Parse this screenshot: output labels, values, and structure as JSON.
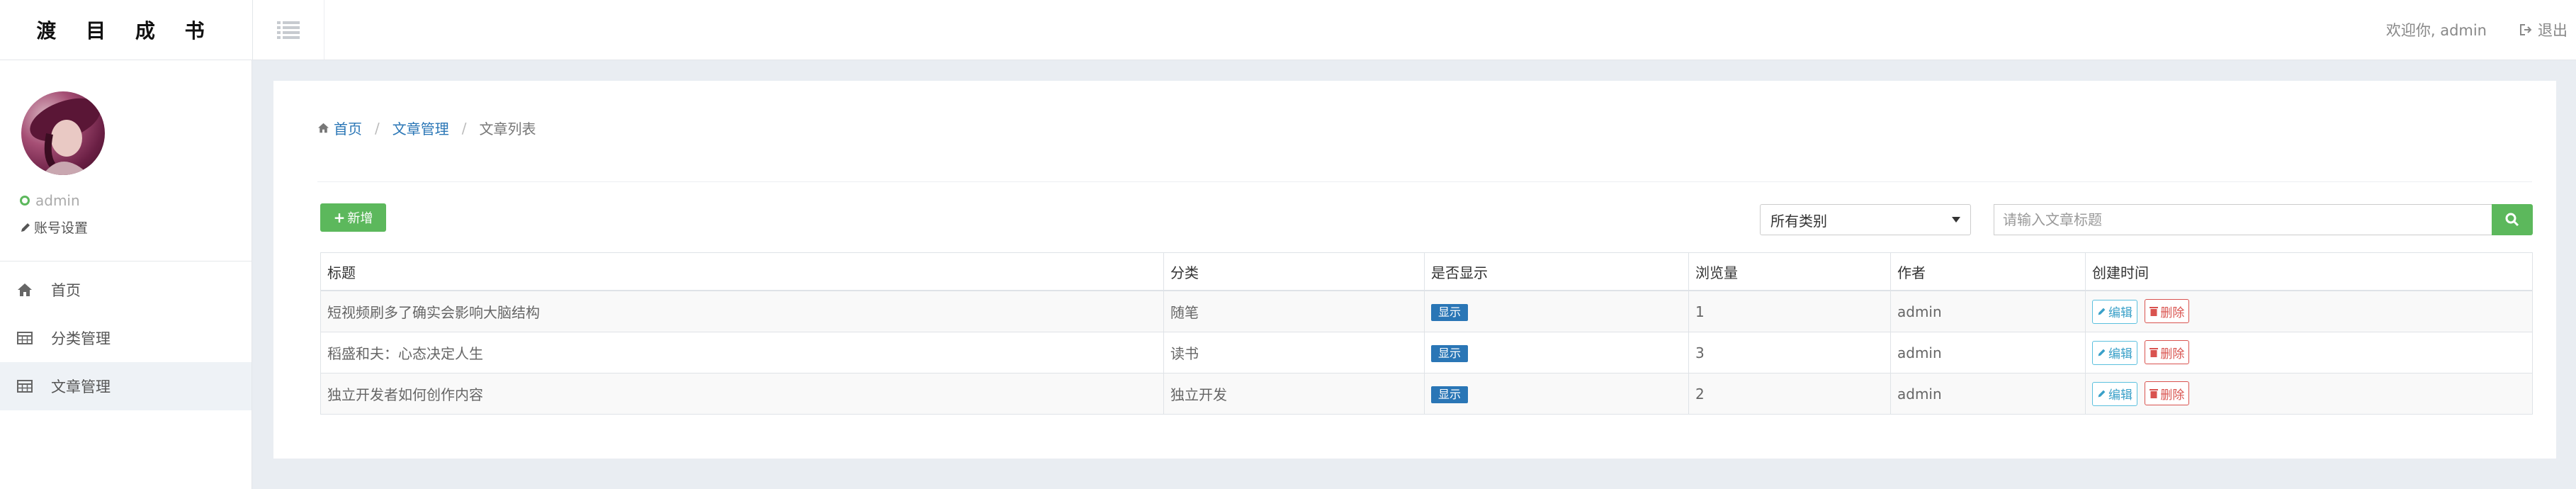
{
  "brand": {
    "title": "渡 目 成 书"
  },
  "header": {
    "welcome": "欢迎你, admin",
    "logout": "退出"
  },
  "sidebar": {
    "username": "admin",
    "account_settings": "账号设置",
    "items": [
      {
        "label": "首页",
        "icon": "home-icon"
      },
      {
        "label": "分类管理",
        "icon": "table-icon"
      },
      {
        "label": "文章管理",
        "icon": "table-icon",
        "active": true
      }
    ]
  },
  "breadcrumb": {
    "home": "首页",
    "section": "文章管理",
    "current": "文章列表",
    "separator": "/"
  },
  "toolbar": {
    "add_label": "新增",
    "category_select": "所有类别",
    "search_placeholder": "请输入文章标题"
  },
  "table": {
    "headers": [
      "标题",
      "分类",
      "是否显示",
      "浏览量",
      "作者",
      "创建时间"
    ],
    "rows": [
      {
        "title": "短视频刷多了确实会影响大脑结构",
        "category": "随笔",
        "visible": "显示",
        "views": "1",
        "author": "admin"
      },
      {
        "title": "稻盛和夫：心态决定人生",
        "category": "读书",
        "visible": "显示",
        "views": "3",
        "author": "admin"
      },
      {
        "title": "独立开发者如何创作内容",
        "category": "独立开发",
        "visible": "显示",
        "views": "2",
        "author": "admin"
      }
    ],
    "edit_label": "编辑",
    "delete_label": "删除"
  },
  "colors": {
    "primary": "#2a76b6",
    "success": "#5cb85c",
    "danger": "#d9534f",
    "info": "#5bc0de"
  }
}
